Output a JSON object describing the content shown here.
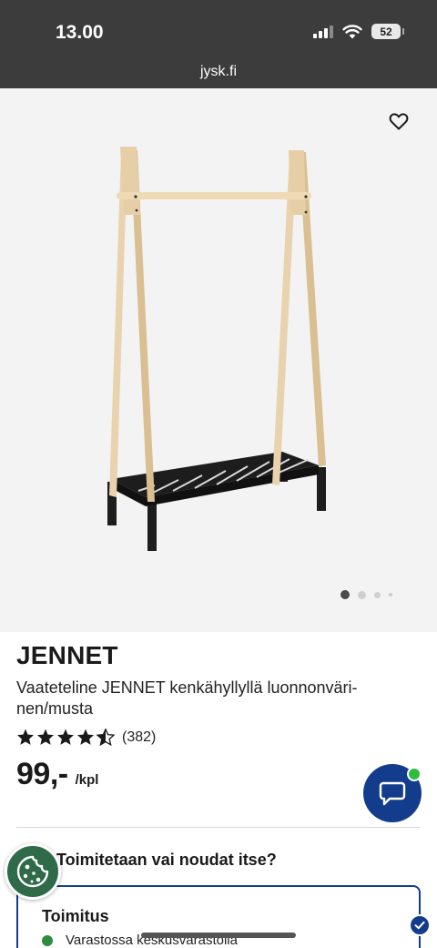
{
  "status_bar": {
    "time": "13.00",
    "battery": "52",
    "url": "jysk.fi",
    "icons": [
      "signal-icon",
      "wifi-icon",
      "battery-icon"
    ]
  },
  "gallery": {
    "favorite_icon": "heart-outline-icon",
    "image_count": 4,
    "active_index": 0
  },
  "product": {
    "brand": "JENNET",
    "description": "Vaateteline JENNET kenkähyllyllä luonnonväri-nen/musta",
    "rating_value": 4.5,
    "rating_count": "(382)",
    "price": "99,-",
    "unit": "/kpl"
  },
  "chat": {
    "icon": "chat-bubble-icon",
    "online_color": "#2ebd3b"
  },
  "delivery": {
    "question": "Toimitetaan vai noudat itse?",
    "option": {
      "title": "Toimitus",
      "stock_text": "Varastossa keskusvarastolla",
      "selected": true
    }
  },
  "colors": {
    "status_bar": "#3c3c3c",
    "accent_blue": "#143c8c",
    "stock_green": "#2e8a3c",
    "cookie_green": "#2f6b48"
  }
}
